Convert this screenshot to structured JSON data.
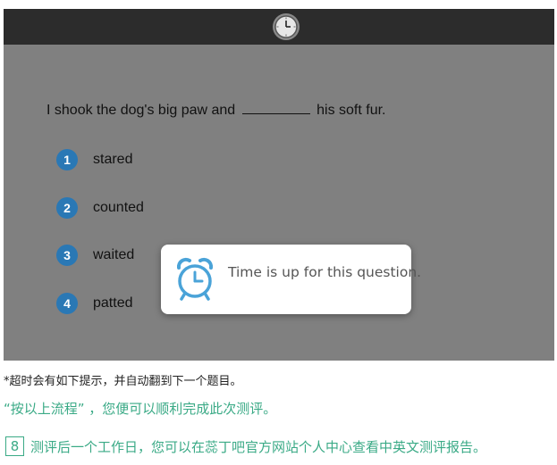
{
  "question": {
    "before_blank": "I shook the dog's big paw and",
    "after_blank": "his soft fur."
  },
  "options": [
    {
      "number": "1",
      "label": "stared"
    },
    {
      "number": "2",
      "label": "counted"
    },
    {
      "number": "3",
      "label": "waited"
    },
    {
      "number": "4",
      "label": "patted"
    }
  ],
  "popup": {
    "message": "Time is up for this question.",
    "icon": "alarm-clock-icon"
  },
  "topbar": {
    "icon": "clock-icon"
  },
  "caption": {
    "note": "*超时会有如下提示，并自动翻到下一个题目。",
    "flow_line": "“按以上流程” ，您便可以顺利完成此次测评。",
    "step_number": "8",
    "step_text": "测评后一个工作日，您可以在蕊丁吧官方网站个人中心查看中英文测评报告。"
  },
  "colors": {
    "topbar": "#2c2c2c",
    "overlay": "#808080",
    "option_badge": "#2a78b5",
    "alarm": "#4aa3d8",
    "caption_green": "#3aaa86"
  }
}
